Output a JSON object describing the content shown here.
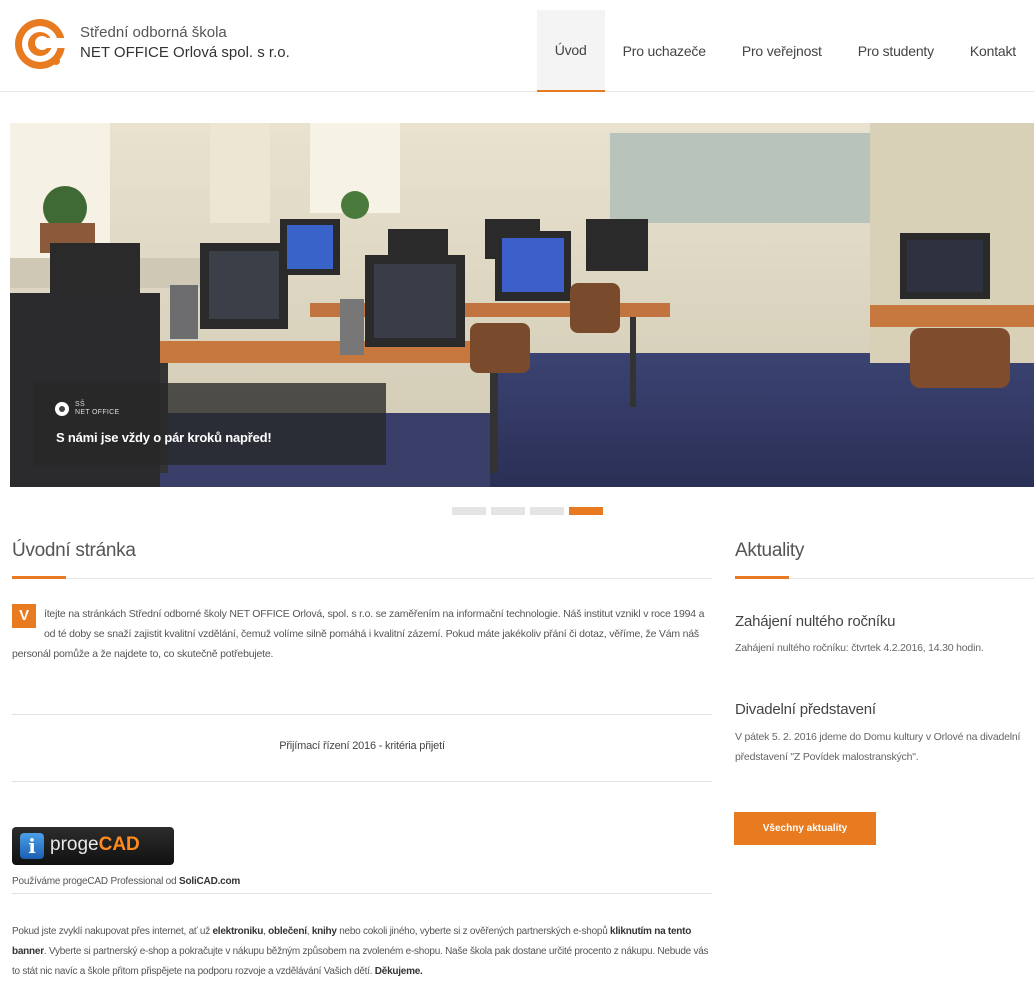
{
  "brand": {
    "line1": "Střední odborná škola",
    "line2": "NET OFFICE Orlová spol. s r.o."
  },
  "nav": [
    {
      "label": "Úvod"
    },
    {
      "label": "Pro uchazeče"
    },
    {
      "label": "Pro veřejnost"
    },
    {
      "label": "Pro studenty"
    },
    {
      "label": "Kontakt"
    }
  ],
  "hero": {
    "logo_text_1": "SŠ",
    "logo_text_2": "NET OFFICE",
    "caption": "S námi jse vždy o pár kroků napřed!",
    "slide_count": 4,
    "active_slide": 4
  },
  "main": {
    "title": "Úvodní stránka",
    "dropcap": "V",
    "intro": "ítejte na stránkách Střední odborné školy NET OFFICE Orlová, spol. s r.o. se zaměřením na informační technologie. Náš institut vznikl v roce 1994 a od té doby se snaží zajistit kvalitní vzdělání, čemuž volíme silně pomáhá i kvalitní zázemí. Pokud máte jakékoliv přání či dotaz, věříme, že Vám náš personál pomůže a že najdete to, co skutečně potřebujete.",
    "admission_link": "Přijímací řízení 2016 - kritéria přijetí",
    "progecad": {
      "brand_a": "proge",
      "brand_b": "CAD",
      "icon_letter": "i"
    },
    "uses_prefix": "Používáme progeCAD Professional od ",
    "uses_link": "SoliCAD.com",
    "shop": {
      "t1": "Pokud jste zvyklí nakupovat přes internet, ať už ",
      "b1": "elektroniku",
      "t2": ", ",
      "b2": "oblečení",
      "t3": ", ",
      "b3": "knihy",
      "t4": " nebo cokoli jiného, vyberte si z ověřených partnerských e-shopů ",
      "b4": "kliknutím na tento banner",
      "t5": ". Vyberte si partnerský e-shop a pokračujte v nákupu běžným způsobem na zvoleném e-shopu. Naše škola pak dostane určité procento z nákupu. Nebude vás to stát nic navíc a škole přitom přispějete na podporu rozvoje a vzdělávání Vašich dětí. ",
      "b5": "Děkujeme."
    }
  },
  "sidebar": {
    "title": "Aktuality",
    "items": [
      {
        "title": "Zahájení nultého ročníku",
        "text": "Zahájení nultého ročníku: čtvrtek 4.2.2016, 14.30 hodin."
      },
      {
        "title": "Divadelní představení",
        "text": "V pátek 5. 2. 2016 jdeme do Domu kultury v Orlové na divadelní představení \"Z Povídek malostranských\"."
      }
    ],
    "button": "Všechny aktuality"
  },
  "colors": {
    "accent": "#e87a1f"
  }
}
